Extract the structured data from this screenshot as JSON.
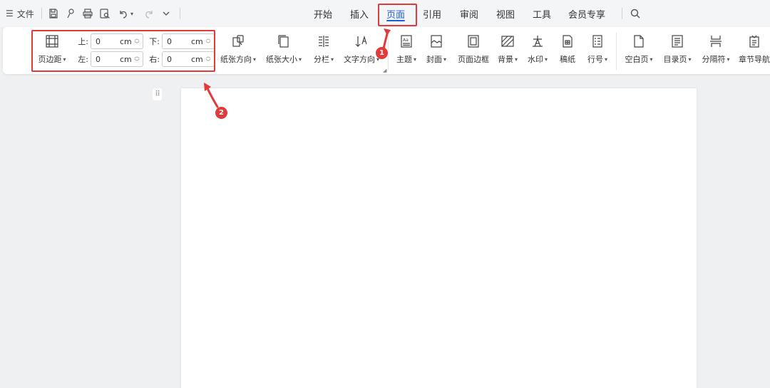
{
  "topbar": {
    "file_menu": "文件",
    "tabs": [
      "开始",
      "插入",
      "页面",
      "引用",
      "审阅",
      "视图",
      "工具",
      "会员专享"
    ],
    "active_tab": "页面"
  },
  "ribbon": {
    "margins": {
      "button_label": "页边距",
      "top_label": "上:",
      "bottom_label": "下:",
      "left_label": "左:",
      "right_label": "右:",
      "top_value": "0",
      "bottom_value": "0",
      "left_value": "0",
      "right_value": "0",
      "unit": "cm"
    },
    "buttons": {
      "orientation": "纸张方向",
      "size": "纸张大小",
      "columns": "分栏",
      "text_direction": "文字方向",
      "theme": "主题",
      "cover": "封面",
      "border": "页面边框",
      "background": "背景",
      "watermark": "水印",
      "manuscript": "稿纸",
      "line_number": "行号",
      "blank_page": "空白页",
      "toc_page": "目录页",
      "separator": "分隔符",
      "chapter_nav": "章节导航"
    }
  },
  "annotations": {
    "step1": "1",
    "step2": "2"
  },
  "colors": {
    "accent": "#1f5fd6",
    "annotation": "#e03a3a"
  }
}
